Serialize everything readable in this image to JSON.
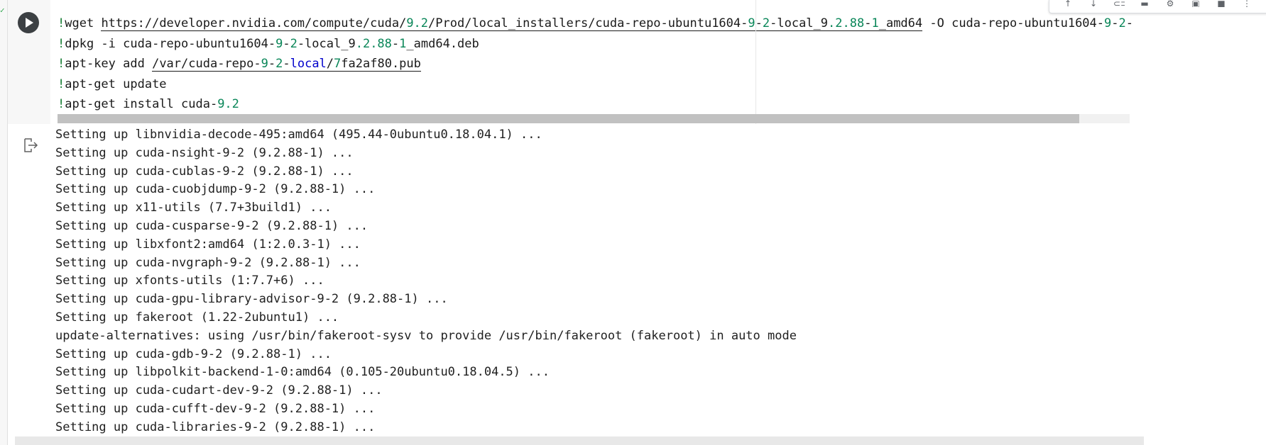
{
  "code": {
    "lines": [
      [
        {
          "t": "!",
          "c": "bang"
        },
        {
          "t": "wget ",
          "c": ""
        },
        {
          "t": "https://developer.nvidia.com/compute/cuda/",
          "c": "link"
        },
        {
          "t": "9.2",
          "c": "num link"
        },
        {
          "t": "/Prod/local_installers/cuda-repo-ubuntu1604-",
          "c": "link"
        },
        {
          "t": "9",
          "c": "num link"
        },
        {
          "t": "-",
          "c": "link"
        },
        {
          "t": "2",
          "c": "num link"
        },
        {
          "t": "-local_",
          "c": "link"
        },
        {
          "t": "9",
          "c": "link"
        },
        {
          "t": ".2.88",
          "c": "num link"
        },
        {
          "t": "-",
          "c": "link"
        },
        {
          "t": "1",
          "c": "num link"
        },
        {
          "t": "_amd64",
          "c": "link"
        },
        {
          "t": " -O cuda-repo-ubuntu1604-",
          "c": ""
        },
        {
          "t": "9",
          "c": "num"
        },
        {
          "t": "-",
          "c": ""
        },
        {
          "t": "2",
          "c": "num"
        },
        {
          "t": "-",
          "c": ""
        }
      ],
      [
        {
          "t": "!",
          "c": "bang"
        },
        {
          "t": "dpkg -i cuda-repo-ubuntu1604-",
          "c": ""
        },
        {
          "t": "9",
          "c": "num"
        },
        {
          "t": "-",
          "c": ""
        },
        {
          "t": "2",
          "c": "num"
        },
        {
          "t": "-local_",
          "c": ""
        },
        {
          "t": "9",
          "c": ""
        },
        {
          "t": ".2.88",
          "c": "num"
        },
        {
          "t": "-",
          "c": ""
        },
        {
          "t": "1",
          "c": "num"
        },
        {
          "t": "_amd64.deb",
          "c": ""
        }
      ],
      [
        {
          "t": "!",
          "c": "bang"
        },
        {
          "t": "apt-key add ",
          "c": ""
        },
        {
          "t": "/var/cuda-repo-",
          "c": "link"
        },
        {
          "t": "9",
          "c": "num link"
        },
        {
          "t": "-",
          "c": "link"
        },
        {
          "t": "2",
          "c": "num link"
        },
        {
          "t": "-",
          "c": "link"
        },
        {
          "t": "local",
          "c": "kw link"
        },
        {
          "t": "/",
          "c": "link"
        },
        {
          "t": "7",
          "c": "num link"
        },
        {
          "t": "fa2af80.pub",
          "c": "link"
        }
      ],
      [
        {
          "t": "!",
          "c": "bang"
        },
        {
          "t": "apt-get update",
          "c": ""
        }
      ],
      [
        {
          "t": "!",
          "c": "bang"
        },
        {
          "t": "apt-get install cuda-",
          "c": ""
        },
        {
          "t": "9.2",
          "c": "num"
        }
      ]
    ]
  },
  "output": {
    "lines": [
      "Setting up libnvidia-decode-495:amd64 (495.44-0ubuntu0.18.04.1) ...",
      "Setting up cuda-nsight-9-2 (9.2.88-1) ...",
      "Setting up cuda-cublas-9-2 (9.2.88-1) ...",
      "Setting up cuda-cuobjdump-9-2 (9.2.88-1) ...",
      "Setting up x11-utils (7.7+3build1) ...",
      "Setting up cuda-cusparse-9-2 (9.2.88-1) ...",
      "Setting up libxfont2:amd64 (1:2.0.3-1) ...",
      "Setting up cuda-nvgraph-9-2 (9.2.88-1) ...",
      "Setting up xfonts-utils (1:7.7+6) ...",
      "Setting up cuda-gpu-library-advisor-9-2 (9.2.88-1) ...",
      "Setting up fakeroot (1.22-2ubuntu1) ...",
      "update-alternatives: using /usr/bin/fakeroot-sysv to provide /usr/bin/fakeroot (fakeroot) in auto mode",
      "Setting up cuda-gdb-9-2 (9.2.88-1) ...",
      "Setting up libpolkit-backend-1-0:amd64 (0.105-20ubuntu0.18.04.5) ...",
      "Setting up cuda-cudart-dev-9-2 (9.2.88-1) ...",
      "Setting up cuda-cufft-dev-9-2 (9.2.88-1) ...",
      "Setting up cuda-libraries-9-2 (9.2.88-1) ..."
    ]
  },
  "icons": {
    "run": "play-icon",
    "output": "output-redirect-icon",
    "toolbar": [
      "arrow-up-icon",
      "arrow-down-icon",
      "link-icon",
      "comment-icon",
      "gear-icon",
      "mirror-cell-icon",
      "delete-icon",
      "more-icon"
    ]
  },
  "colors": {
    "run_button": "#3c4043",
    "number": "#098658",
    "keyword": "#0000cc",
    "bang": "#1a7f37"
  }
}
